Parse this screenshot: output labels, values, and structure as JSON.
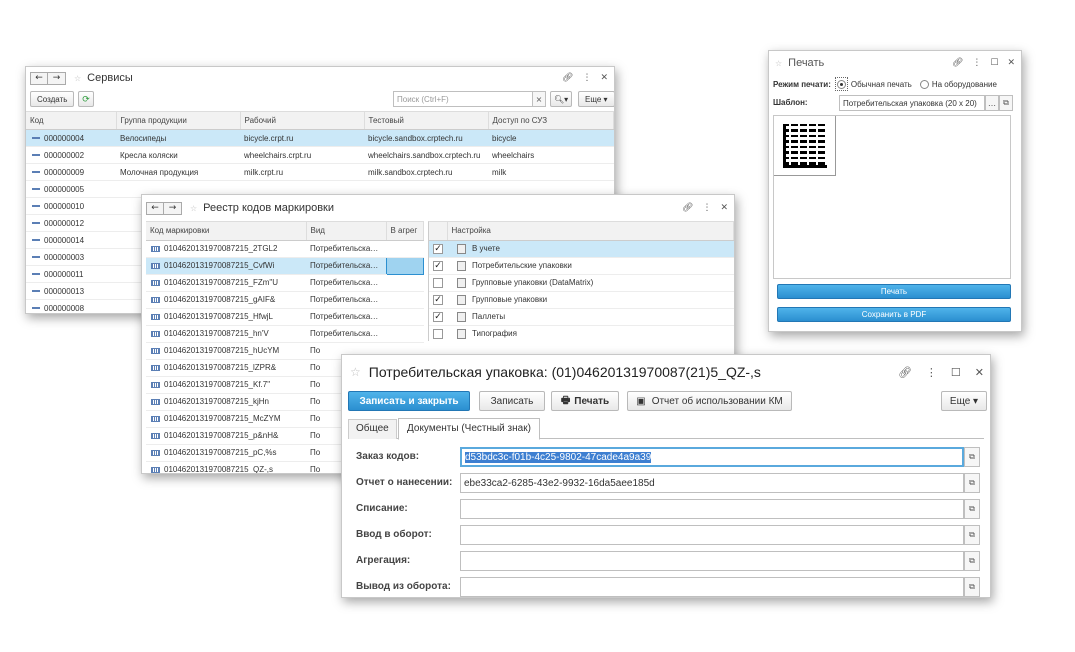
{
  "services": {
    "title": "Сервисы",
    "create_label": "Создать",
    "search_placeholder": "Поиск (Ctrl+F)",
    "more_label": "Еще",
    "columns": [
      "Код",
      "Группа продукции",
      "Рабочий",
      "Тестовый",
      "Доступ по СУЗ"
    ],
    "rows": [
      {
        "code": "000000004",
        "group": "Велосипеды",
        "work": "bicycle.crpt.ru",
        "test": "bicycle.sandbox.crptech.ru",
        "suz": "bicycle"
      },
      {
        "code": "000000002",
        "group": "Кресла коляски",
        "work": "wheelchairs.crpt.ru",
        "test": "wheelchairs.sandbox.crptech.ru",
        "suz": "wheelchairs"
      },
      {
        "code": "000000009",
        "group": "Молочная продукция",
        "work": "milk.crpt.ru",
        "test": "milk.sandbox.crptech.ru",
        "suz": "milk"
      },
      {
        "code": "000000005",
        "group": "",
        "work": "",
        "test": "",
        "suz": ""
      },
      {
        "code": "000000010",
        "group": "",
        "work": "",
        "test": "",
        "suz": ""
      },
      {
        "code": "000000012",
        "group": "",
        "work": "",
        "test": "",
        "suz": ""
      },
      {
        "code": "000000014",
        "group": "",
        "work": "",
        "test": "",
        "suz": ""
      },
      {
        "code": "000000003",
        "group": "",
        "work": "",
        "test": "",
        "suz": ""
      },
      {
        "code": "000000011",
        "group": "",
        "work": "",
        "test": "",
        "suz": ""
      },
      {
        "code": "000000013",
        "group": "",
        "work": "",
        "test": "",
        "suz": ""
      },
      {
        "code": "000000008",
        "group": "",
        "work": "",
        "test": "",
        "suz": ""
      }
    ]
  },
  "registry": {
    "title": "Реестр кодов маркировки",
    "columns": [
      "Код маркировки",
      "Вид",
      "В агрег"
    ],
    "rows": [
      {
        "code": "0104620131970087215_2TGL2",
        "kind": "Потребительская ..."
      },
      {
        "code": "0104620131970087215_CvfWi",
        "kind": "Потребительская ..."
      },
      {
        "code": "0104620131970087215_FZm\"U",
        "kind": "Потребительская ..."
      },
      {
        "code": "0104620131970087215_gAIF&",
        "kind": "Потребительская ..."
      },
      {
        "code": "0104620131970087215_HfwjL",
        "kind": "Потребительская ..."
      },
      {
        "code": "0104620131970087215_hn'V",
        "kind": "Потребительская ..."
      },
      {
        "code": "0104620131970087215_hUcYM",
        "kind": "По"
      },
      {
        "code": "0104620131970087215_lZPR&",
        "kind": "По"
      },
      {
        "code": "0104620131970087215_Kf.7\"",
        "kind": "По"
      },
      {
        "code": "0104620131970087215_kjHn",
        "kind": "По"
      },
      {
        "code": "0104620131970087215_McZYM",
        "kind": "По"
      },
      {
        "code": "0104620131970087215_p&nH&",
        "kind": "По"
      },
      {
        "code": "0104620131970087215_pC,%s",
        "kind": "По"
      },
      {
        "code": "0104620131970087215_QZ-,s",
        "kind": "По"
      }
    ],
    "settings_header": "Настройка",
    "settings": [
      {
        "label": "В учете",
        "checked": true
      },
      {
        "label": "Потребительские упаковки",
        "checked": true
      },
      {
        "label": "Групповые упаковки (DataMatrix)",
        "checked": false
      },
      {
        "label": "Групповые упаковки",
        "checked": true
      },
      {
        "label": "Паллеты",
        "checked": true
      },
      {
        "label": "Типография",
        "checked": false
      }
    ]
  },
  "print": {
    "title": "Печать",
    "mode_label": "Режим печати:",
    "mode_normal": "Обычная печать",
    "mode_device": "На оборудование",
    "template_label": "Шаблон:",
    "template_value": "Потребительская упаковка (20 х 20)",
    "print_button": "Печать",
    "save_pdf_button": "Сохранить в PDF"
  },
  "package": {
    "title": "Потребительская упаковка: (01)04620131970087(21)5_QZ-,s",
    "save_close": "Записать и закрыть",
    "save": "Записать",
    "print": "Печать",
    "report": "Отчет об использовании КМ",
    "more": "Еще",
    "tab_general": "Общее",
    "tab_docs": "Документы (Честный знак)",
    "fields": [
      {
        "label": "Заказ кодов:",
        "value": "d53bdc3c-f01b-4c25-9802-47cade4a9a39"
      },
      {
        "label": "Отчет о нанесении:",
        "value": "ebe33ca2-6285-43e2-9932-16da5aee185d"
      },
      {
        "label": "Списание:",
        "value": ""
      },
      {
        "label": "Ввод в оборот:",
        "value": ""
      },
      {
        "label": "Агрегация:",
        "value": ""
      },
      {
        "label": "Вывод из оборота:",
        "value": ""
      }
    ]
  }
}
